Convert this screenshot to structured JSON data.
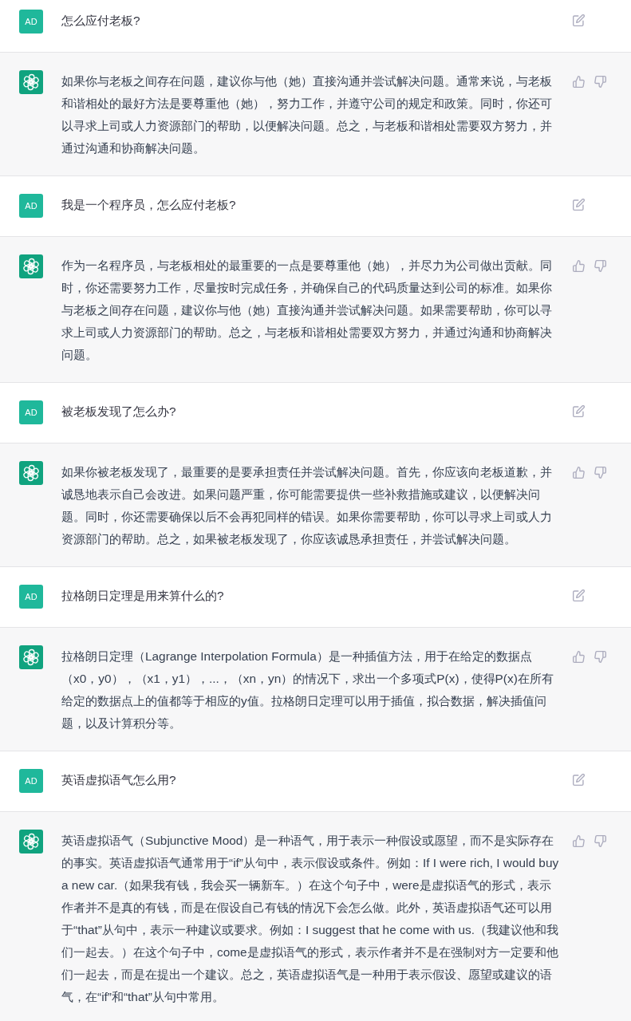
{
  "messages": [
    {
      "kind": "user",
      "avatar": "AD",
      "text": "怎么应付老板?"
    },
    {
      "kind": "assistant",
      "text": "如果你与老板之间存在问题，建议你与他（她）直接沟通并尝试解决问题。通常来说，与老板和谐相处的最好方法是要尊重他（她），努力工作，并遵守公司的规定和政策。同时，你还可以寻求上司或人力资源部门的帮助，以便解决问题。总之，与老板和谐相处需要双方努力，并通过沟通和协商解决问题。"
    },
    {
      "kind": "user",
      "avatar": "AD",
      "text": "我是一个程序员，怎么应付老板?"
    },
    {
      "kind": "assistant",
      "text": "作为一名程序员，与老板相处的最重要的一点是要尊重他（她），并尽力为公司做出贡献。同时，你还需要努力工作，尽量按时完成任务，并确保自己的代码质量达到公司的标准。如果你与老板之间存在问题，建议你与他（她）直接沟通并尝试解决问题。如果需要帮助，你可以寻求上司或人力资源部门的帮助。总之，与老板和谐相处需要双方努力，并通过沟通和协商解决问题。"
    },
    {
      "kind": "user",
      "avatar": "AD",
      "text": "被老板发现了怎么办?"
    },
    {
      "kind": "assistant",
      "text": "如果你被老板发现了，最重要的是要承担责任并尝试解决问题。首先，你应该向老板道歉，并诚恳地表示自己会改进。如果问题严重，你可能需要提供一些补救措施或建议，以便解决问题。同时，你还需要确保以后不会再犯同样的错误。如果你需要帮助，你可以寻求上司或人力资源部门的帮助。总之，如果被老板发现了，你应该诚恳承担责任，并尝试解决问题。"
    },
    {
      "kind": "user",
      "avatar": "AD",
      "text": "拉格朗日定理是用来算什么的?"
    },
    {
      "kind": "assistant",
      "text": "拉格朗日定理（Lagrange Interpolation Formula）是一种插值方法，用于在给定的数据点（x0，y0），（x1，y1），...，（xn，yn）的情况下，求出一个多项式P(x)，使得P(x)在所有给定的数据点上的值都等于相应的y值。拉格朗日定理可以用于插值，拟合数据，解决插值问题，以及计算积分等。"
    },
    {
      "kind": "user",
      "avatar": "AD",
      "text": "英语虚拟语气怎么用?"
    },
    {
      "kind": "assistant",
      "text": "英语虚拟语气（Subjunctive Mood）是一种语气，用于表示一种假设或愿望，而不是实际存在的事实。英语虚拟语气通常用于“if”从句中，表示假设或条件。例如：If I were rich, I would buy a new car.（如果我有钱，我会买一辆新车。）在这个句子中，were是虚拟语气的形式，表示作者并不是真的有钱，而是在假设自己有钱的情况下会怎么做。此外，英语虚拟语气还可以用于“that”从句中，表示一种建议或要求。例如：I suggest that he come with us.（我建议他和我们一起去。）在这个句子中，come是虚拟语气的形式，表示作者并不是在强制对方一定要和他们一起去，而是在提出一个建议。总之，英语虚拟语气是一种用于表示假设、愿望或建议的语气，在“if”和“that”从句中常用。"
    }
  ]
}
